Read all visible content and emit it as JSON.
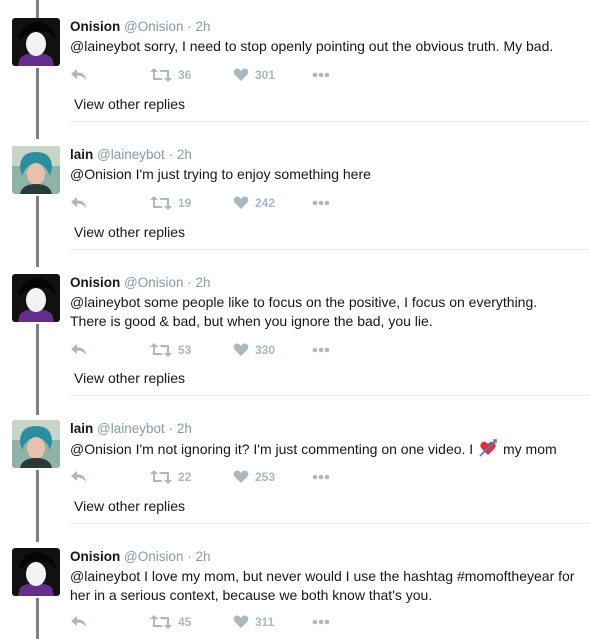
{
  "tweets": [
    {
      "avatar": "onision-avatar",
      "name": "Onision",
      "handle": "@Onision",
      "time": "2h",
      "text": "@laineybot sorry, I need to stop openly pointing out the obvious truth. My bad.",
      "retweets": "36",
      "likes": "301",
      "view_other": "View other replies"
    },
    {
      "avatar": "lain-avatar",
      "name": "lain",
      "handle": "@laineybot",
      "time": "2h",
      "text": "@Onision I'm just trying to enjoy something here",
      "retweets": "19",
      "likes": "242",
      "view_other": "View other replies"
    },
    {
      "avatar": "onision-avatar",
      "name": "Onision",
      "handle": "@Onision",
      "time": "2h",
      "text": "@laineybot some people like to focus on the positive, I focus on everything. There is good & bad, but when you ignore the bad, you lie.",
      "retweets": "53",
      "likes": "330",
      "view_other": "View other replies"
    },
    {
      "avatar": "lain-avatar",
      "name": "lain",
      "handle": "@laineybot",
      "time": "2h",
      "text_before": "@Onision I'm not ignoring it? I'm just commenting on one video. I",
      "text_emoji": "heart-with-arrow-emoji",
      "text_after": "my mom",
      "retweets": "22",
      "likes": "253",
      "view_other": "View other replies"
    },
    {
      "avatar": "onision-avatar",
      "name": "Onision",
      "handle": "@Onision",
      "time": "2h",
      "text": "@laineybot I love my mom, but never would I use the hashtag #momoftheyear for her in a serious context, because we both know that's you.",
      "retweets": "45",
      "likes": "311"
    }
  ],
  "separator": "·",
  "colors": {
    "text": "#14171a",
    "muted": "#8899a6",
    "action": "#aab8c2",
    "thread_line": "#808080",
    "divider": "#e6ecf0"
  },
  "icons": [
    "reply-icon",
    "retweet-icon",
    "like-icon",
    "more-icon"
  ]
}
